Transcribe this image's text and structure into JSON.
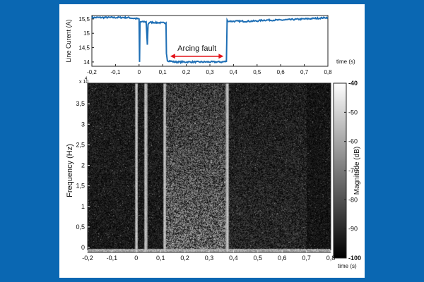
{
  "chart_data": [
    {
      "type": "line",
      "ylabel": "Line Curent (A)",
      "xlabel": "time (s)",
      "xlim": [
        -0.2,
        0.8
      ],
      "ylim": [
        13.85,
        15.62
      ],
      "x_ticks": [
        "-0,2",
        "-0,1",
        "0",
        "0,1",
        "0,2",
        "0,3",
        "0,4",
        "0,5",
        "0,6",
        "0,7",
        "0,8"
      ],
      "x_tick_values": [
        -0.2,
        -0.1,
        0,
        0.1,
        0.2,
        0.3,
        0.4,
        0.5,
        0.6,
        0.7,
        0.8
      ],
      "y_ticks": [
        "14",
        "14,5",
        "15",
        "15,5"
      ],
      "y_tick_values": [
        14,
        14.5,
        15,
        15.5
      ],
      "color": "#1f6fb5",
      "series": [
        {
          "x": [
            -0.2,
            -0.15,
            -0.1,
            -0.05,
            0.0,
            0.002,
            0.004,
            0.006,
            0.01,
            0.02,
            0.03,
            0.035,
            0.038,
            0.04,
            0.045,
            0.06,
            0.08,
            0.1,
            0.114,
            0.116,
            0.12,
            0.15,
            0.2,
            0.25,
            0.3,
            0.35,
            0.37,
            0.373,
            0.38,
            0.42,
            0.46,
            0.5,
            0.53,
            0.56,
            0.6,
            0.65,
            0.7,
            0.75,
            0.8
          ],
          "y": [
            15.55,
            15.55,
            15.55,
            15.55,
            15.5,
            14.0,
            15.35,
            15.4,
            15.4,
            15.4,
            15.4,
            14.6,
            15.3,
            15.35,
            15.38,
            15.38,
            15.37,
            15.36,
            15.36,
            14.3,
            14.05,
            14.0,
            14.0,
            14.0,
            14.0,
            14.0,
            14.02,
            15.45,
            15.42,
            15.42,
            15.42,
            15.43,
            15.46,
            15.46,
            15.46,
            15.48,
            15.5,
            15.52,
            15.55
          ]
        }
      ],
      "annotations": [
        {
          "text": "Arcing fault",
          "x_range": [
            0.12,
            0.37
          ],
          "y": 14.2,
          "color": "#e3141b"
        }
      ]
    },
    {
      "type": "heatmap",
      "ylabel": "Frequency (Hz)",
      "xlabel": "time (s)",
      "xlim": [
        -0.2,
        0.8
      ],
      "ylim": [
        -0.12,
        4.0
      ],
      "exponent_label": "x 10",
      "exponent_power": "4",
      "x_ticks": [
        "-0,2",
        "-0,1",
        "0",
        "0,1",
        "0,2",
        "0,3",
        "0,4",
        "0,5",
        "0,6",
        "0,7",
        "0,8"
      ],
      "x_tick_values": [
        -0.2,
        -0.1,
        0,
        0.1,
        0.2,
        0.3,
        0.4,
        0.5,
        0.6,
        0.7,
        0.8
      ],
      "y_ticks": [
        "0",
        "0,5",
        "1",
        "1,5",
        "2",
        "2,5",
        "3",
        "3,5"
      ],
      "y_tick_values": [
        0,
        0.5,
        1,
        1.5,
        2,
        2.5,
        3,
        3.5
      ],
      "colorbar": {
        "label": "Magnitude (dB)",
        "range": [
          -100,
          -40
        ],
        "ticks": [
          "-40",
          "-50",
          "-60",
          "-70",
          "-80",
          "-90",
          "-100"
        ],
        "tick_values": [
          -40,
          -50,
          -60,
          -70,
          -80,
          -90,
          -100
        ]
      },
      "bright_lines_x": [
        0.0,
        0.038,
        0.116,
        0.373
      ],
      "arcing_band_x": [
        0.12,
        0.37
      ],
      "dark_band_x": [
        0.7,
        0.8
      ]
    }
  ]
}
